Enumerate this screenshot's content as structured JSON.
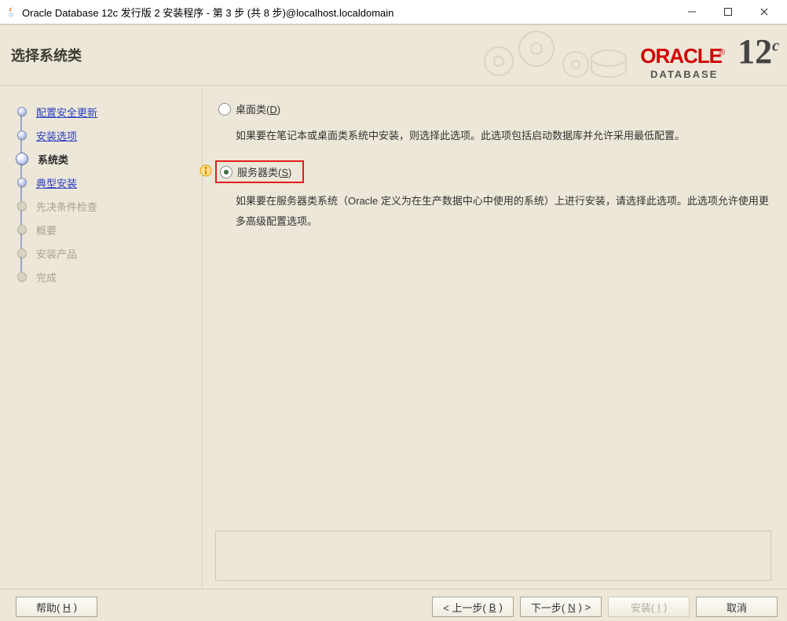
{
  "titlebar": {
    "title": "Oracle Database 12c 发行版 2 安装程序 - 第 3 步 (共 8 步)@localhost.localdomain"
  },
  "header": {
    "title": "选择系统类",
    "brand_oracle": "ORACLE",
    "brand_database": "DATABASE",
    "brand_version": "12",
    "brand_suffix": "c"
  },
  "sidebar": {
    "items": [
      {
        "label": "配置安全更新",
        "state": "done",
        "link": true
      },
      {
        "label": "安装选项",
        "state": "done",
        "link": true
      },
      {
        "label": "系统类",
        "state": "current",
        "link": false
      },
      {
        "label": "典型安装",
        "state": "next",
        "link": true
      },
      {
        "label": "先决条件检查",
        "state": "future",
        "link": false
      },
      {
        "label": "概要",
        "state": "future",
        "link": false
      },
      {
        "label": "安装产品",
        "state": "future",
        "link": false
      },
      {
        "label": "完成",
        "state": "future",
        "link": false
      }
    ]
  },
  "content": {
    "options": [
      {
        "id": "desktop",
        "label_prefix": "桌面类(",
        "accel": "D",
        "label_suffix": ")",
        "selected": false,
        "highlighted": false,
        "description": "如果要在笔记本或桌面类系统中安装，则选择此选项。此选项包括启动数据库并允许采用最低配置。"
      },
      {
        "id": "server",
        "label_prefix": "服务器类(",
        "accel": "S",
        "label_suffix": ")",
        "selected": true,
        "highlighted": true,
        "description": "如果要在服务器类系统（Oracle 定义为在生产数据中心中使用的系统）上进行安装，请选择此选项。此选项允许使用更多高级配置选项。"
      }
    ]
  },
  "footer": {
    "help_prefix": "帮助(",
    "help_accel": "H",
    "help_suffix": ")",
    "back_prefix": "< 上一步(",
    "back_accel": "B",
    "back_suffix": ")",
    "next_prefix": "下一步(",
    "next_accel": "N",
    "next_suffix": ") >",
    "install_prefix": "安装(",
    "install_accel": "I",
    "install_suffix": ")",
    "cancel": "取消"
  }
}
